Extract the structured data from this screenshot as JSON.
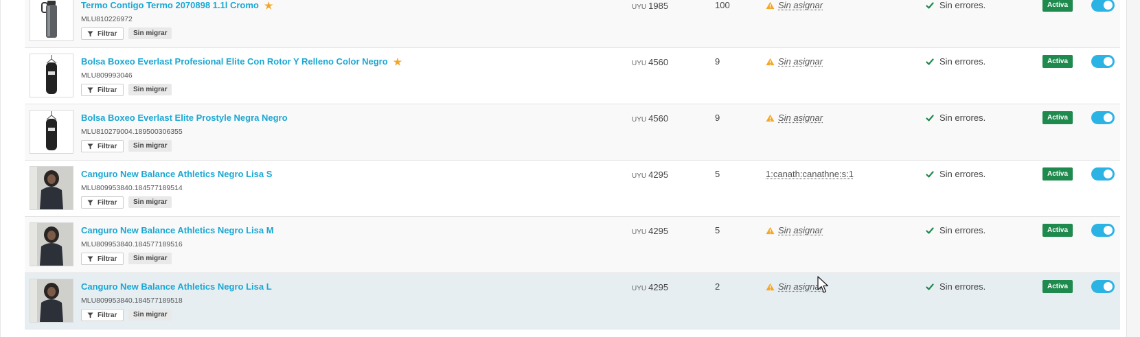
{
  "currency_label": "UYU",
  "filter_label": "Filtrar",
  "migrate_label": "Sin migrar",
  "errors_label": "Sin errores.",
  "status_label": "Activa",
  "unassigned_label": "Sin asignar",
  "colors": {
    "link": "#1aa7d3",
    "status_green": "#1e8a4d",
    "toggle_blue": "#2bb3e4",
    "star": "#f5a623",
    "warning": "#f5a623",
    "check": "#1e8a4d"
  },
  "rows": [
    {
      "title": "Termo Contigo Termo 2070898 1.1l Cromo",
      "starred": true,
      "sku": "MLU810226972",
      "price": "1985",
      "stock": "100",
      "assignment": "Sin asignar",
      "assignment_warning": true,
      "thumb": "thermos-image"
    },
    {
      "title": "Bolsa Boxeo Everlast Profesional Elite Con Rotor Y Relleno Color Negro",
      "starred": true,
      "sku": "MLU809993046",
      "price": "4560",
      "stock": "9",
      "assignment": "Sin asignar",
      "assignment_warning": true,
      "thumb": "punching-bag-image"
    },
    {
      "title": "Bolsa Boxeo Everlast Elite Prostyle Negra Negro",
      "starred": false,
      "sku": "MLU810279004.189500306355",
      "price": "4560",
      "stock": "9",
      "assignment": "Sin asignar",
      "assignment_warning": true,
      "thumb": "punching-bag-image"
    },
    {
      "title": "Canguro New Balance Athletics Negro Lisa S",
      "starred": false,
      "sku": "MLU809953840.184577189514",
      "price": "4295",
      "stock": "5",
      "assignment": "1:canath:canathne:s:1",
      "assignment_warning": false,
      "thumb": "hoodie-model-image"
    },
    {
      "title": "Canguro New Balance Athletics Negro Lisa M",
      "starred": false,
      "sku": "MLU809953840.184577189516",
      "price": "4295",
      "stock": "5",
      "assignment": "Sin asignar",
      "assignment_warning": true,
      "thumb": "hoodie-model-image"
    },
    {
      "title": "Canguro New Balance Athletics Negro Lisa L",
      "starred": false,
      "sku": "MLU809953840.184577189518",
      "price": "4295",
      "stock": "2",
      "assignment": "Sin asignar",
      "assignment_warning": true,
      "thumb": "hoodie-model-image"
    }
  ]
}
